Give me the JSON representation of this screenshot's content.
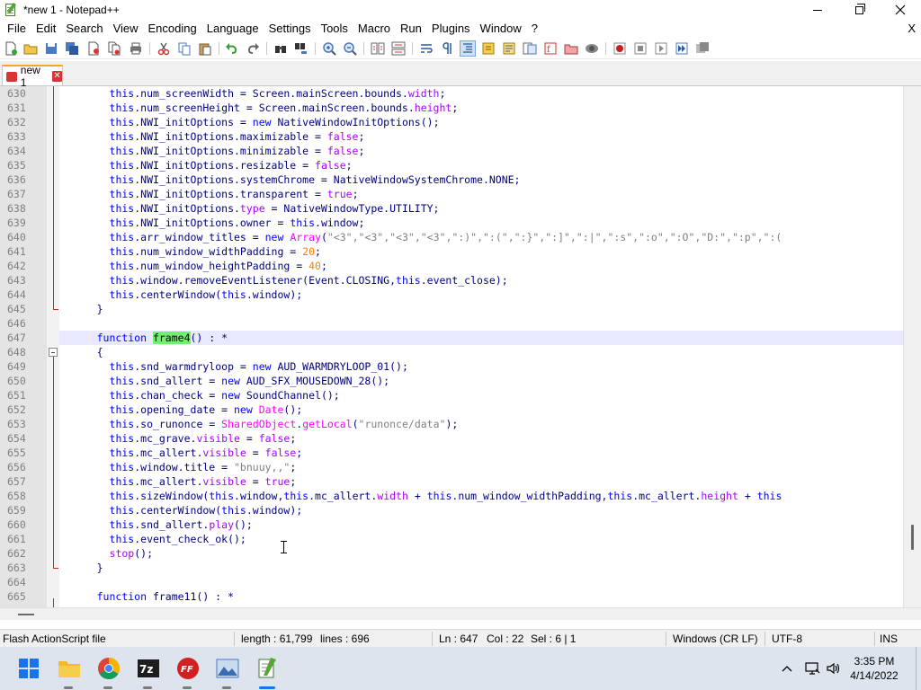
{
  "window": {
    "title": "*new 1 - Notepad++"
  },
  "menu": [
    {
      "label": "File"
    },
    {
      "label": "Edit"
    },
    {
      "label": "Search"
    },
    {
      "label": "View"
    },
    {
      "label": "Encoding"
    },
    {
      "label": "Language"
    },
    {
      "label": "Settings"
    },
    {
      "label": "Tools"
    },
    {
      "label": "Macro"
    },
    {
      "label": "Run"
    },
    {
      "label": "Plugins"
    },
    {
      "label": "Window"
    },
    {
      "label": "?"
    }
  ],
  "menu_close": "X",
  "tabs": [
    {
      "label": "new 1",
      "close": "✕"
    }
  ],
  "editor": {
    "current_line": "647",
    "lines": [
      {
        "n": "630",
        "t": [
          [
            "kw",
            "this"
          ],
          [
            "plain",
            ".num_screenWidth = Screen.mainScreen.bounds."
          ],
          [
            "prop",
            "width"
          ],
          [
            "plain",
            ";"
          ]
        ]
      },
      {
        "n": "631",
        "t": [
          [
            "kw",
            "this"
          ],
          [
            "plain",
            ".num_screenHeight = Screen.mainScreen.bounds."
          ],
          [
            "prop",
            "height"
          ],
          [
            "plain",
            ";"
          ]
        ]
      },
      {
        "n": "632",
        "t": [
          [
            "kw",
            "this"
          ],
          [
            "plain",
            ".NWI_initOptions = "
          ],
          [
            "kw",
            "new"
          ],
          [
            "plain",
            " NativeWindowInitOptions();"
          ]
        ]
      },
      {
        "n": "633",
        "t": [
          [
            "kw",
            "this"
          ],
          [
            "plain",
            ".NWI_initOptions.maximizable = "
          ],
          [
            "bool",
            "false"
          ],
          [
            "plain",
            ";"
          ]
        ]
      },
      {
        "n": "634",
        "t": [
          [
            "kw",
            "this"
          ],
          [
            "plain",
            ".NWI_initOptions.minimizable = "
          ],
          [
            "bool",
            "false"
          ],
          [
            "plain",
            ";"
          ]
        ]
      },
      {
        "n": "635",
        "t": [
          [
            "kw",
            "this"
          ],
          [
            "plain",
            ".NWI_initOptions.resizable = "
          ],
          [
            "bool",
            "false"
          ],
          [
            "plain",
            ";"
          ]
        ]
      },
      {
        "n": "636",
        "t": [
          [
            "kw",
            "this"
          ],
          [
            "plain",
            ".NWI_initOptions.systemChrome = NativeWindowSystemChrome.NONE;"
          ]
        ]
      },
      {
        "n": "637",
        "t": [
          [
            "kw",
            "this"
          ],
          [
            "plain",
            ".NWI_initOptions.transparent = "
          ],
          [
            "bool",
            "true"
          ],
          [
            "plain",
            ";"
          ]
        ]
      },
      {
        "n": "638",
        "t": [
          [
            "kw",
            "this"
          ],
          [
            "plain",
            ".NWI_initOptions."
          ],
          [
            "prop",
            "type"
          ],
          [
            "plain",
            " = NativeWindowType.UTILITY;"
          ]
        ]
      },
      {
        "n": "639",
        "t": [
          [
            "kw",
            "this"
          ],
          [
            "plain",
            ".NWI_initOptions.owner = "
          ],
          [
            "kw",
            "this"
          ],
          [
            "plain",
            ".window;"
          ]
        ]
      },
      {
        "n": "640",
        "t": [
          [
            "kw",
            "this"
          ],
          [
            "plain",
            ".arr_window_titles = "
          ],
          [
            "kw",
            "new"
          ],
          [
            "plain",
            " "
          ],
          [
            "cls",
            "Array"
          ],
          [
            "plain",
            "("
          ],
          [
            "str",
            "\"<3\",\"<3\",\"<3\",\"<3\",\":)\",\":(\",\":}\",\":]\",\":|\",\":s\",\":o\",\":O\",\"D:\",\":p\",\":("
          ]
        ]
      },
      {
        "n": "641",
        "t": [
          [
            "kw",
            "this"
          ],
          [
            "plain",
            ".num_window_widthPadding = "
          ],
          [
            "num",
            "20"
          ],
          [
            "plain",
            ";"
          ]
        ]
      },
      {
        "n": "642",
        "t": [
          [
            "kw",
            "this"
          ],
          [
            "plain",
            ".num_window_heightPadding = "
          ],
          [
            "num",
            "40"
          ],
          [
            "plain",
            ";"
          ]
        ]
      },
      {
        "n": "643",
        "t": [
          [
            "kw",
            "this"
          ],
          [
            "plain",
            ".window.removeEventListener(Event.CLOSING,"
          ],
          [
            "kw",
            "this"
          ],
          [
            "plain",
            ".event_close);"
          ]
        ]
      },
      {
        "n": "644",
        "t": [
          [
            "kw",
            "this"
          ],
          [
            "plain",
            ".centerWindow("
          ],
          [
            "kw",
            "this"
          ],
          [
            "plain",
            ".window);"
          ]
        ]
      },
      {
        "n": "645",
        "t": [
          [
            "plain",
            "}"
          ]
        ]
      },
      {
        "n": "646",
        "t": []
      },
      {
        "n": "647",
        "t": [
          [
            "kw",
            "function"
          ],
          [
            "plain",
            " "
          ],
          [
            "hl",
            "frame4"
          ],
          [
            "plain",
            "() : *"
          ]
        ]
      },
      {
        "n": "648",
        "t": [
          [
            "plain",
            "{"
          ]
        ]
      },
      {
        "n": "649",
        "t": [
          [
            "kw",
            "this"
          ],
          [
            "plain",
            ".snd_warmdryloop = "
          ],
          [
            "kw",
            "new"
          ],
          [
            "plain",
            " AUD_WARMDRYLOOP_01();"
          ]
        ]
      },
      {
        "n": "650",
        "t": [
          [
            "kw",
            "this"
          ],
          [
            "plain",
            ".snd_allert = "
          ],
          [
            "kw",
            "new"
          ],
          [
            "plain",
            " AUD_SFX_MOUSEDOWN_28();"
          ]
        ]
      },
      {
        "n": "651",
        "t": [
          [
            "kw",
            "this"
          ],
          [
            "plain",
            ".chan_check = "
          ],
          [
            "kw",
            "new"
          ],
          [
            "plain",
            " SoundChannel();"
          ]
        ]
      },
      {
        "n": "652",
        "t": [
          [
            "kw",
            "this"
          ],
          [
            "plain",
            ".opening_date = "
          ],
          [
            "kw",
            "new"
          ],
          [
            "plain",
            " "
          ],
          [
            "cls",
            "Date"
          ],
          [
            "plain",
            "();"
          ]
        ]
      },
      {
        "n": "653",
        "t": [
          [
            "kw",
            "this"
          ],
          [
            "plain",
            ".so_runonce = "
          ],
          [
            "cls",
            "SharedObject"
          ],
          [
            "plain",
            "."
          ],
          [
            "cls",
            "getLocal"
          ],
          [
            "plain",
            "("
          ],
          [
            "str",
            "\"runonce/data\""
          ],
          [
            "plain",
            ");"
          ]
        ]
      },
      {
        "n": "654",
        "t": [
          [
            "kw",
            "this"
          ],
          [
            "plain",
            ".mc_grave."
          ],
          [
            "prop",
            "visible"
          ],
          [
            "plain",
            " = "
          ],
          [
            "bool",
            "false"
          ],
          [
            "plain",
            ";"
          ]
        ]
      },
      {
        "n": "655",
        "t": [
          [
            "kw",
            "this"
          ],
          [
            "plain",
            ".mc_allert."
          ],
          [
            "prop",
            "visible"
          ],
          [
            "plain",
            " = "
          ],
          [
            "bool",
            "false"
          ],
          [
            "plain",
            ";"
          ]
        ]
      },
      {
        "n": "656",
        "t": [
          [
            "kw",
            "this"
          ],
          [
            "plain",
            ".window.title = "
          ],
          [
            "str",
            "\"bnuuy,,\""
          ],
          [
            "plain",
            ";"
          ]
        ]
      },
      {
        "n": "657",
        "t": [
          [
            "kw",
            "this"
          ],
          [
            "plain",
            ".mc_allert."
          ],
          [
            "prop",
            "visible"
          ],
          [
            "plain",
            " = "
          ],
          [
            "bool",
            "true"
          ],
          [
            "plain",
            ";"
          ]
        ]
      },
      {
        "n": "658",
        "t": [
          [
            "kw",
            "this"
          ],
          [
            "plain",
            ".sizeWindow("
          ],
          [
            "kw",
            "this"
          ],
          [
            "plain",
            ".window,"
          ],
          [
            "kw",
            "this"
          ],
          [
            "plain",
            ".mc_allert."
          ],
          [
            "prop",
            "width"
          ],
          [
            "plain",
            " + "
          ],
          [
            "kw",
            "this"
          ],
          [
            "plain",
            ".num_window_widthPadding,"
          ],
          [
            "kw",
            "this"
          ],
          [
            "plain",
            ".mc_allert."
          ],
          [
            "prop",
            "height"
          ],
          [
            "plain",
            " + "
          ],
          [
            "kw",
            "this"
          ]
        ]
      },
      {
        "n": "659",
        "t": [
          [
            "kw",
            "this"
          ],
          [
            "plain",
            ".centerWindow("
          ],
          [
            "kw",
            "this"
          ],
          [
            "plain",
            ".window);"
          ]
        ]
      },
      {
        "n": "660",
        "t": [
          [
            "kw",
            "this"
          ],
          [
            "plain",
            ".snd_allert."
          ],
          [
            "prop",
            "play"
          ],
          [
            "plain",
            "();"
          ]
        ]
      },
      {
        "n": "661",
        "t": [
          [
            "kw",
            "this"
          ],
          [
            "plain",
            ".event_check_ok();"
          ]
        ]
      },
      {
        "n": "662",
        "t": [
          [
            "prop",
            "stop"
          ],
          [
            "plain",
            "();"
          ]
        ]
      },
      {
        "n": "663",
        "t": [
          [
            "plain",
            "}"
          ]
        ]
      },
      {
        "n": "664",
        "t": []
      },
      {
        "n": "665",
        "t": [
          [
            "kw",
            "function"
          ],
          [
            "plain",
            " frame11() : *"
          ]
        ]
      }
    ]
  },
  "status": {
    "language": "Flash ActionScript file",
    "length": "length : 61,799",
    "lines": "lines : 696",
    "ln": "Ln : 647",
    "col": "Col : 22",
    "sel": "Sel : 6 | 1",
    "eol": "Windows (CR LF)",
    "encoding": "UTF-8",
    "mode": "INS"
  },
  "taskbar": {
    "time": "3:35 PM",
    "date": "4/14/2022",
    "apps": [
      "start-icon",
      "file-explorer-icon",
      "chrome-icon",
      "7zip-icon",
      "ffdec-icon",
      "photos-icon",
      "notepadpp-icon"
    ]
  },
  "colors": {
    "keyword": "#0000ff",
    "boolean": "#aa00ff",
    "number": "#ff8000",
    "string": "#808080",
    "current_line": "#e8e8ff",
    "match_highlight": "#74ed74",
    "fold_line": "#d32020",
    "taskbar": "#dde4ed"
  }
}
